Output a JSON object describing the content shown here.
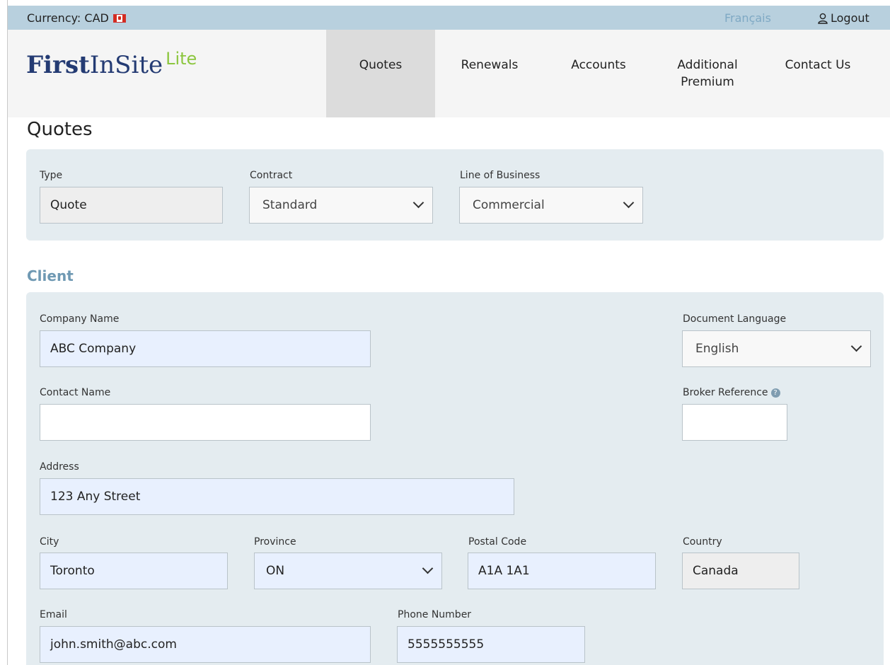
{
  "topbar": {
    "currency_label": "Currency: CAD",
    "language_link": "Français",
    "logout_label": "Logout"
  },
  "brand": {
    "name_bold": "First",
    "name_regular": "InSite",
    "suffix": "Lite"
  },
  "nav": {
    "items": [
      {
        "label": "Quotes",
        "active": true
      },
      {
        "label": "Renewals",
        "active": false
      },
      {
        "label": "Accounts",
        "active": false
      },
      {
        "label": "Additional Premium",
        "active": false
      },
      {
        "label": "Contact Us",
        "active": false
      }
    ]
  },
  "page": {
    "title": "Quotes"
  },
  "quote_settings": {
    "type": {
      "label": "Type",
      "value": "Quote"
    },
    "contract": {
      "label": "Contract",
      "value": "Standard"
    },
    "line_of_business": {
      "label": "Line of Business",
      "value": "Commercial"
    }
  },
  "client": {
    "section_title": "Client",
    "company_name": {
      "label": "Company Name",
      "value": "ABC Company"
    },
    "document_language": {
      "label": "Document Language",
      "value": "English"
    },
    "contact_name": {
      "label": "Contact Name",
      "value": ""
    },
    "broker_reference": {
      "label": "Broker Reference",
      "value": ""
    },
    "address": {
      "label": "Address",
      "value": "123 Any Street"
    },
    "city": {
      "label": "City",
      "value": "Toronto"
    },
    "province": {
      "label": "Province",
      "value": "ON"
    },
    "postal_code": {
      "label": "Postal Code",
      "value": "A1A 1A1"
    },
    "country": {
      "label": "Country",
      "value": "Canada"
    },
    "email": {
      "label": "Email",
      "value": "john.smith@abc.com"
    },
    "phone_number": {
      "label": "Phone Number",
      "value": "5555555555"
    }
  },
  "colors": {
    "topbar_bg": "#b8d0de",
    "panel_bg": "#e4ecf0",
    "brand_blue": "#243b73",
    "brand_green": "#8cc63f",
    "section_title": "#6f99b3",
    "autofill_bg": "#e8f0fe"
  }
}
